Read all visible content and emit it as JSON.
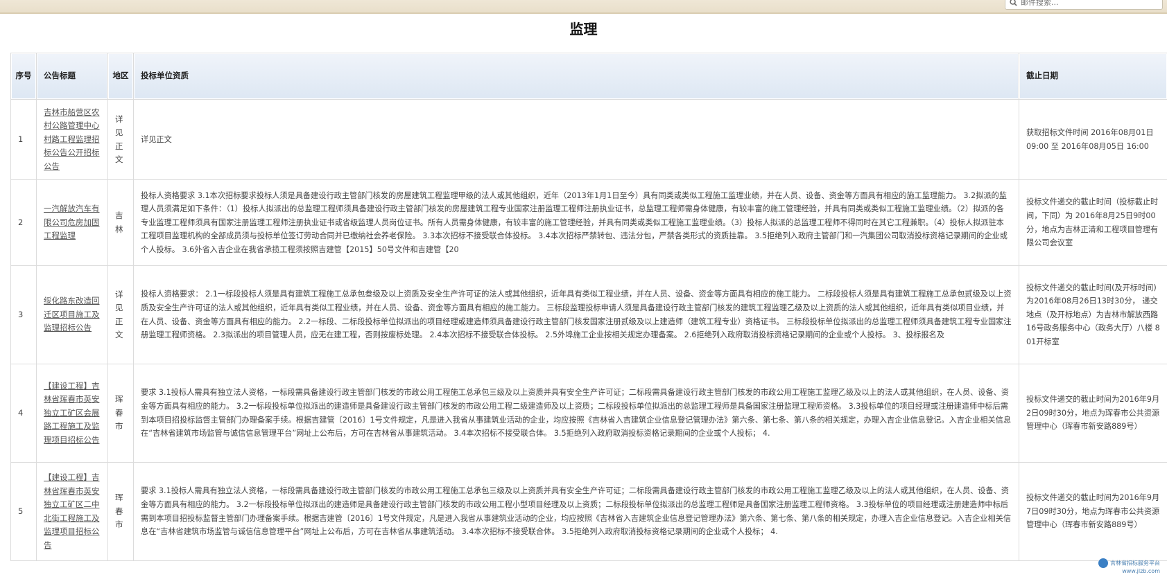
{
  "search": {
    "placeholder": "邮件搜索..."
  },
  "page_title": "监理",
  "table": {
    "headers": {
      "no": "序号",
      "title": "公告标题",
      "region": "地区",
      "qualification": "投标单位资质",
      "deadline": "截止日期"
    },
    "rows": [
      {
        "no": "1",
        "title": "吉林市船营区农村公路管理中心村路工程监理招标公告公开招标公告",
        "region": "详见正文",
        "qualification": "详见正文",
        "deadline": "获取招标文件时间 2016年08月01日 09:00 至 2016年08月05日 16:00"
      },
      {
        "no": "2",
        "title": "一汽解放汽车有限公司危房加固工程监理",
        "region": "吉林",
        "qualification": "投标人资格要求 3.1本次招标要求投标人须是具备建设行政主管部门核发的房屋建筑工程监理甲级的法人或其他组织，近年（2013年1月1日至今）具有同类或类似工程施工监理业绩，并在人员、设备、资金等方面具有相应的施工监理能力。 3.2拟派的监理人员须满足如下条件：（1）投标人拟派出的总监理工程师须具备建设行政主管部门核发的房屋建筑工程专业国家注册监理工程师注册执业证书，总监理工程师需身体健康，有较丰富的施工管理经验，并具有同类或类似工程施工监理业绩。（2）拟派的各专业监理工程师须具有国家注册监理工程师注册执业证书或省级监理人员岗位证书。所有人员需身体健康，有较丰富的施工管理经验，并具有同类或类似工程施工监理业绩。（3）投标人拟派的总监理工程师不得同时在其它工程兼职。（4）投标人拟派驻本工程项目监理机构的全部成员须与投标单位签订劳动合同并已缴纳社会养老保险。 3.3本次招标不接受联合体投标。 3.4本次招标严禁转包、违法分包，严禁各类形式的资质挂靠。 3.5拒绝列入政府主管部门和一汽集团公司取消投标资格记录期间的企业或个人投标。 3.6外省入吉企业在我省承揽工程须按照吉建管【2015】50号文件和吉建管【20",
        "deadline": "投标文件递交的截止时间（投标截止时间，下同）为 2016年8月25日9时00分，地点为吉林正清和工程项目管理有限公司会议室"
      },
      {
        "no": "3",
        "title": "绥化路东改造回迁区项目施工及监理招标公告",
        "region": "详见正文",
        "qualification": "投标人资格要求： 2.1一标段投标人须是具有建筑工程施工总承包叁级及以上资质及安全生产许可证的法人或其他组织，近年具有类似工程业绩，并在人员、设备、资金等方面具有相应的施工能力。 二标段投标人须是具有建筑工程施工总承包贰级及以上资质及安全生产许可证的法人或其他组织，近年具有类似工程业绩，并在人员、设备、资金等方面具有相应的施工能力。 三标段监理投标申请人须是具备建设行政主管部门核发的建筑工程监理乙级及以上资质的法人或其他组织，近年具有类似项目业绩，并在人员、设备、资金等方面具有相应的能力。 2.2一标段、二标段投标单位拟派出的项目经理或建造师须具备建设行政主管部门核发国家注册贰级及以上建造师（建筑工程专业）资格证书。 三标段投标单位拟派出的总监理工程师须具备建筑工程专业国家注册监理工程师资格。 2.3拟派出的项目管理人员，应无在建工程，否则按废标处理。 2.4本次招标不接受联合体投标。 2.5外埠施工企业按相关规定办理备案。 2.6拒绝列入政府取消投标资格记录期间的企业或个人投标。 3、投标报名及",
        "deadline": "投标文件递交的截止时间(及开标时间)为2016年08月26日13时30分， 递交地点（及开标地点）为吉林市解放西路16号政务服务中心（政务大厅）八楼 801开标室"
      },
      {
        "no": "4",
        "title": "【建设工程】吉林省珲春市英安独立工矿区会展路工程施工及监理项目招标公告",
        "region": "珲春市",
        "qualification": "要求 3.1投标人需具有独立法人资格，一标段需具备建设行政主管部门核发的市政公用工程施工总承包三级及以上资质并具有安全生产许可证；二标段需具备建设行政主管部门核发的市政公用工程施工监理乙级及以上的法人或其他组织，在人员、设备、资金等方面具有相应的能力。 3.2一标段投标单位拟派出的建造师是具备建设行政主管部门核发的市政公用工程二级建造师及以上资质；二标段投标单位拟派出的总监理工程师是具备国家注册监理工程师资格。 3.3投标单位的项目经理或注册建造师中标后需到本项目招投标监督主管部门办理备案手续。根据吉建管〔2016〕1号文件规定，凡是进入我省从事建筑业活动的企业，均应按照《吉林省入吉建筑企业信息登记管理办法》第六条、第七条、第八条的相关规定，办理入吉企业信息登记。入吉企业相关信息在“吉林省建筑市场监管与诚信信息管理平台”网址上公布后，方可在吉林省从事建筑活动。 3.4本次招标不接受联合体。 3.5拒绝列入政府取消投标资格记录期间的企业或个人投标； 4.",
        "deadline": "投标文件递交的截止时间为2016年9月2日09时30分，地点为珲春市公共资源管理中心（珲春市新安路889号）"
      },
      {
        "no": "5",
        "title": "【建设工程】吉林省珲春市英安独立工矿区二中北街工程施工及监理项目招标公告",
        "region": "珲春市",
        "qualification": "要求 3.1投标人需具有独立法人资格，一标段需具备建设行政主管部门核发的市政公用工程施工总承包三级及以上资质并具有安全生产许可证；二标段需具备建设行政主管部门核发的市政公用工程施工监理乙级及以上的法人或其他组织，在人员、设备、资金等方面具有相应的能力。 3.2一标段投标单位拟派出的建造师是具备建设行政主管部门核发的市政公用工程小型项目经理及以上资质；二标段投标单位拟派出的总监理工程师是具备国家注册监理工程师资格。 3.3投标单位的项目经理或注册建造师中标后需到本项目招投标监督主管部门办理备案手续。根据吉建管〔2016〕1号文件规定，凡是进入我省从事建筑业活动的企业，均应按照《吉林省入吉建筑企业信息登记管理办法》第六条、第七条、第八条的相关规定，办理入吉企业信息登记。入吉企业相关信息在“吉林省建筑市场监管与诚信信息管理平台”网址上公布后，方可在吉林省从事建筑活动。 3.4本次招标不接受联合体。 3.5拒绝列入政府取消投标资格记录期间的企业或个人投标； 4.",
        "deadline": "投标文件递交的截止时间为2016年9月7日09时30分，地点为珲春市公共资源管理中心（珲春市新安路889号）"
      }
    ]
  },
  "watermark": {
    "line1": "吉林省招标服务平台",
    "line2": "www.jlzb.com"
  }
}
